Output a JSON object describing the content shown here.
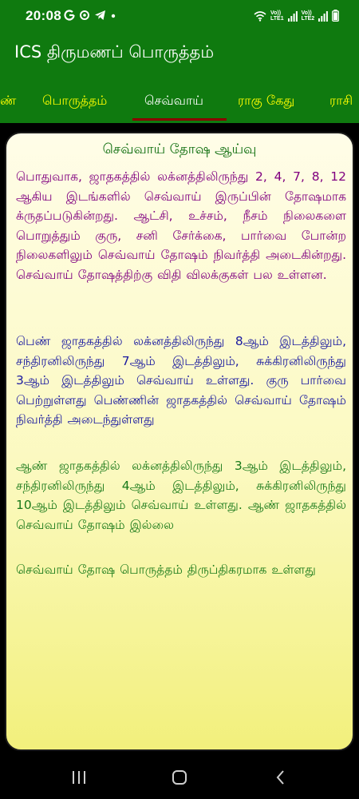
{
  "status_bar": {
    "time": "20:08",
    "left_icons": [
      "g-icon",
      "notification-icon",
      "telegram-icon",
      "dot-icon"
    ],
    "sim1_label": "Vo)) LTE1",
    "sim2_label": "Vo)) LTE2",
    "sim1_label_top": "Vo))",
    "sim1_label_bottom": "LTE1",
    "sim2_label_top": "Vo))",
    "sim2_label_bottom": "LTE2",
    "battery": "battery-icon"
  },
  "app": {
    "title": "ICS திருமணப் பொருத்தம்"
  },
  "tabs": [
    {
      "label": "ண்",
      "active": false
    },
    {
      "label": "பொருத்தம்",
      "active": false
    },
    {
      "label": "செவ்வாய்",
      "active": true
    },
    {
      "label": "ராகு கேது",
      "active": false
    },
    {
      "label": "ராசி",
      "active": false
    }
  ],
  "content": {
    "title": "செவ்வாய் தோஷ ஆய்வு",
    "paragraphs": [
      "பொதுவாக, ஜாதகத்தில் லக்னத்திலிருந்து 2, 4, 7, 8, 12  ஆகிய இடங்களில் செவ்வாய் இருப்பின் தோஷமாக க்ருதப்படுகின்றது. ஆட்சி, உச்சம், நீசம் நிலைகளை பொறுத்தும் குரு, சனி சேர்க்கை, பார்வை போன்ற நிலைகளிலும் செவ்வாய் தோஷம் நிவர்த்தி அடைகின்றது. செவ்வாய் தோஷத்திற்கு விதி விலக்குகள் பல உள்ளன.",
      "பெண் ஜாதகத்தில் லக்னத்திலிருந்து 8ஆம் இடத்திலும், சந்திரனிலிருந்து 7ஆம் இடத்திலும், சுக்கிரனிலிருந்து 3ஆம் இடத்திலும்  செவ்வாய் உள்ளது. குரு பார்வை பெற்றுள்ளது பெண்ணின் ஜாதகத்தில் செவ்வாய் தோஷம் நிவர்த்தி அடைந்துள்ளது",
      "ஆண் ஜாதகத்தில் லக்னத்திலிருந்து 3ஆம் இடத்திலும், சந்திரனிலிருந்து 4ஆம் இடத்திலும், சுக்கிரனிலிருந்து 10ஆம் இடத்திலும்  செவ்வாய் உள்ளது. ஆண் ஜாதகத்தில் செவ்வாய் தோஷம் இல்லை",
      "செவ்வாய் தோஷ பொருத்தம் திருப்திகரமாக உள்ளது"
    ]
  },
  "nav": {
    "icons": [
      "recent-apps-icon",
      "home-icon",
      "back-icon"
    ]
  },
  "colors": {
    "app_bar": "#0f7a0f",
    "tab_text": "#ffff00",
    "tab_active_text": "#ffffff",
    "tab_indicator": "#8b0000",
    "card_title": "#0a6b0a",
    "para1": "#800080",
    "para2": "#1a1aa0",
    "para3": "#1a7a1a"
  }
}
